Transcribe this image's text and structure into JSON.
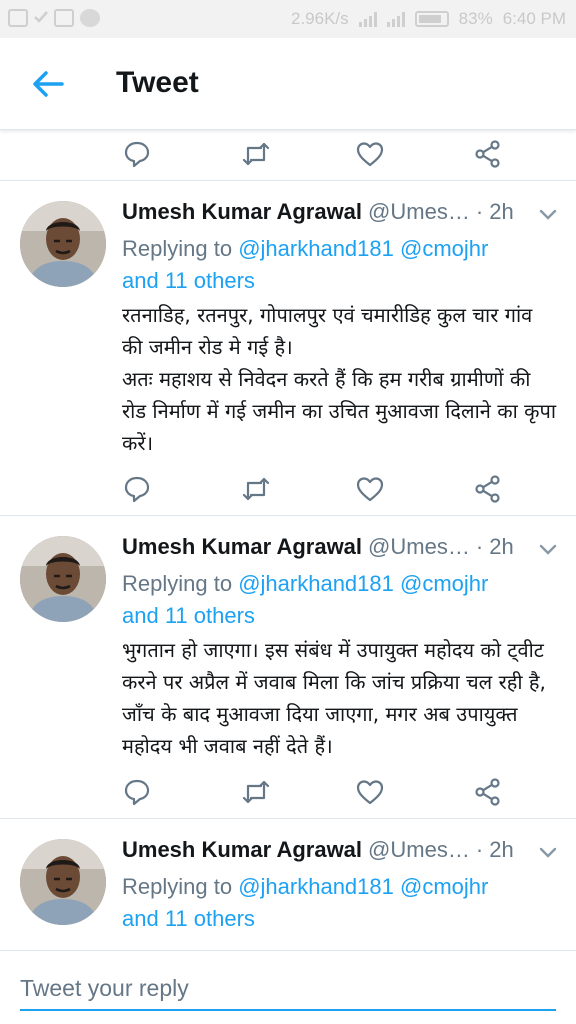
{
  "status_bar": {
    "net_speed": "2.96K/s",
    "network": "4G",
    "battery": "83%",
    "time": "6:40 PM"
  },
  "header": {
    "title": "Tweet",
    "back_icon": "arrow-left-icon"
  },
  "colors": {
    "accent": "#1da1f2",
    "text": "#14171a",
    "muted": "#657786",
    "divider": "#e1e8ed"
  },
  "tweets": [
    {
      "author": "Umesh Kumar Agrawal",
      "handle": "@Umes…",
      "time": "· 2h",
      "replying_prefix": "Replying to",
      "mention_1": "@jharkhand181",
      "mention_2": "@cmojhr",
      "mention_others": "and 11 others",
      "text": "रतनाडिह, रतनपुर, गोपालपुर एवं चमारीडिह कुल चार गांव की जमीन रोड मे गई है।\nअतः महाशय से निवेदन करते हैं कि हम गरीब ग्रामीणों की रोड निर्माण में गई जमीन का उचित मुआवजा दिलाने का कृपा करें।"
    },
    {
      "author": "Umesh Kumar Agrawal",
      "handle": "@Umes…",
      "time": "· 2h",
      "replying_prefix": "Replying to",
      "mention_1": "@jharkhand181",
      "mention_2": "@cmojhr",
      "mention_others": "and 11 others",
      "text": "भुगतान हो जाएगा। इस संबंध में उपायुक्त महोदय को ट्वीट करने पर अप्रैल में जवाब मिला कि जांच प्रक्रिया चल रही है, जाँच के बाद मुआवजा दिया जाएगा, मगर अब उपायुक्त महोदय भी जवाब नहीं देते हैं।"
    },
    {
      "author": "Umesh Kumar Agrawal",
      "handle": "@Umes…",
      "time": "· 2h",
      "replying_prefix": "Replying to",
      "mention_1": "@jharkhand181",
      "mention_2": "@cmojhr",
      "mention_others": "and 11 others",
      "text": ""
    }
  ],
  "action_icons": [
    "reply-icon",
    "retweet-icon",
    "like-icon",
    "share-icon"
  ],
  "reply": {
    "placeholder": "Tweet your reply"
  }
}
